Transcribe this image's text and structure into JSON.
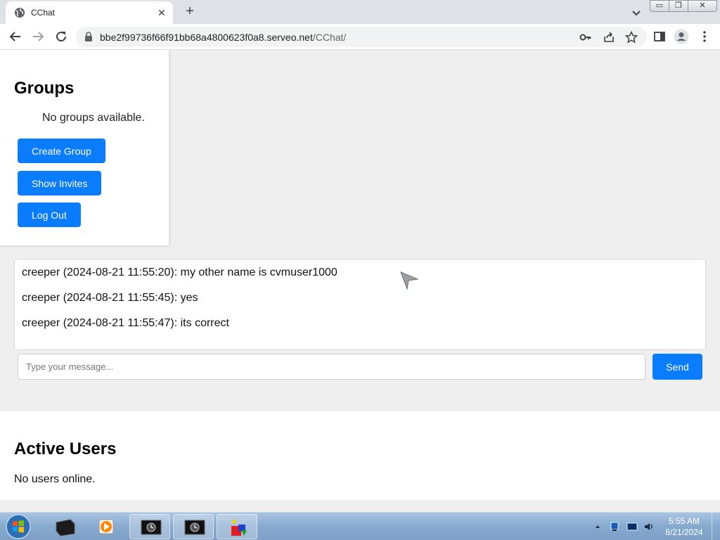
{
  "browser": {
    "tab_title": "CChat",
    "url_host": "bbe2f99736f66f91bb68a4800623f0a8.serveo.net",
    "url_path": "/CChat/",
    "close_glyph": "✕",
    "new_tab_glyph": "+",
    "win_minimize": "▭",
    "win_restore": "❐",
    "win_close": "✕"
  },
  "groups": {
    "title": "Groups",
    "empty_text": "No groups available.",
    "create_label": "Create Group",
    "invites_label": "Show Invites",
    "logout_label": "Log Out"
  },
  "chat": {
    "messages": [
      "creeper (2024-08-21 11:55:20): my other name is cvmuser1000",
      "creeper (2024-08-21 11:55:45): yes",
      "creeper (2024-08-21 11:55:47): its correct"
    ],
    "input_placeholder": "Type your message...",
    "send_label": "Send"
  },
  "users": {
    "title": "Active Users",
    "empty_text": "No users online."
  },
  "taskbar": {
    "time": "5:55 AM",
    "date": "8/21/2024"
  },
  "colors": {
    "accent": "#0a7cff",
    "page_bg": "#efefef"
  },
  "icons": [
    "globe-icon",
    "close-icon",
    "plus-icon",
    "chevron-down-icon",
    "back-arrow-icon",
    "forward-arrow-icon",
    "reload-icon",
    "lock-icon",
    "key-icon",
    "share-icon",
    "star-icon",
    "side-panel-icon",
    "profile-icon",
    "kebab-menu-icon",
    "cursor-icon",
    "windows-start-icon"
  ]
}
